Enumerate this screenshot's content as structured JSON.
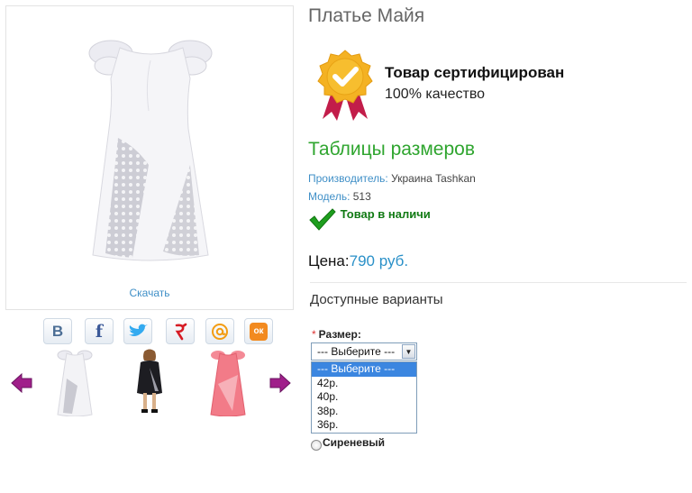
{
  "product": {
    "title": "Платье Майя",
    "download_label": "Скачать"
  },
  "social": {
    "vk": "В",
    "facebook": "f",
    "odnoklassniki": "ок"
  },
  "certificate": {
    "title": "Товар сертифицирован",
    "subtitle": "100% качество"
  },
  "size_tables_link": "Таблицы размеров",
  "manufacturer": {
    "label": "Производитель:",
    "value": "Украина Tashkan"
  },
  "model": {
    "label": "Модель:",
    "value": "513"
  },
  "stock_status": "Товар в наличи",
  "price": {
    "label": "Цена:",
    "value": "790 руб."
  },
  "variants": {
    "title": "Доступные варианты",
    "size_label": "Размер:",
    "required_mark": "*",
    "selected": "--- Выберите ---",
    "options": [
      "--- Выберите ---",
      "42р.",
      "40р.",
      "38р.",
      "36р."
    ],
    "color_option": "Сиреневый"
  },
  "colors": {
    "accent_blue": "#3f8fc7",
    "green": "#2fa52f",
    "arrow": "#a01f8a"
  }
}
